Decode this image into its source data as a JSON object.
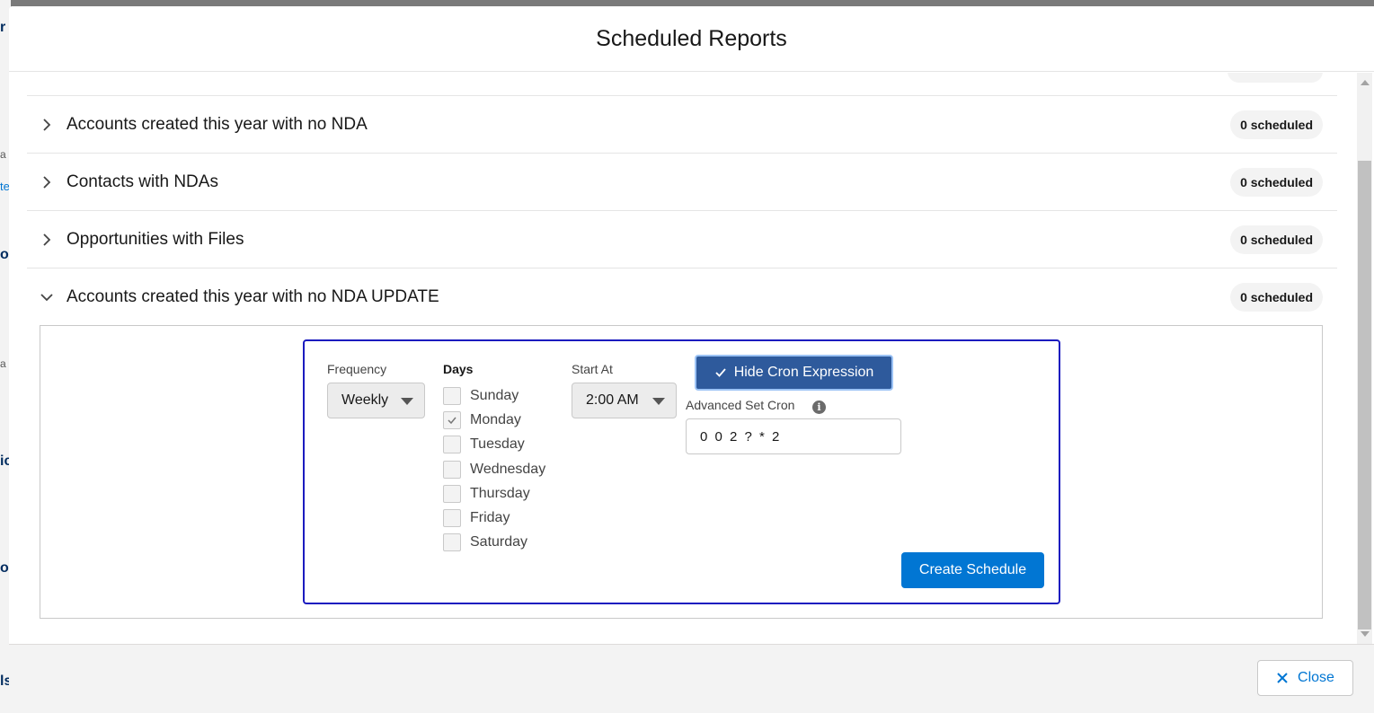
{
  "background": {
    "fragments": [
      "r",
      "a",
      "te",
      "o",
      "a",
      "ic",
      "o",
      "ls"
    ]
  },
  "modal": {
    "title": "Scheduled Reports"
  },
  "reports": [
    {
      "title": "Accounts created this year with no NDA",
      "badge": "0 scheduled",
      "expanded": false
    },
    {
      "title": "Contacts with NDAs",
      "badge": "0 scheduled",
      "expanded": false
    },
    {
      "title": "Opportunities with Files",
      "badge": "0 scheduled",
      "expanded": false
    },
    {
      "title": "Accounts created this year with no NDA UPDATE",
      "badge": "0 scheduled",
      "expanded": true
    }
  ],
  "schedule_form": {
    "frequency_label": "Frequency",
    "frequency_value": "Weekly",
    "days_label": "Days",
    "days": [
      {
        "label": "Sunday",
        "checked": false
      },
      {
        "label": "Monday",
        "checked": true
      },
      {
        "label": "Tuesday",
        "checked": false
      },
      {
        "label": "Wednesday",
        "checked": false
      },
      {
        "label": "Thursday",
        "checked": false
      },
      {
        "label": "Friday",
        "checked": false
      },
      {
        "label": "Saturday",
        "checked": false
      }
    ],
    "start_at_label": "Start At",
    "start_at_value": "2:00 AM",
    "hide_cron_button": "Hide Cron Expression",
    "advanced_cron_label": "Advanced Set Cron",
    "info_icon": "i",
    "cron_value": "0 0 2 ? * 2",
    "create_button": "Create Schedule"
  },
  "footer": {
    "close_label": "Close"
  },
  "colors": {
    "brand_blue": "#0176d3",
    "hide_cron_bg": "#2e5a9c",
    "form_border": "#1b1bbf"
  },
  "icons": {
    "collapsed": "chevron-right-icon",
    "expanded": "chevron-down-icon",
    "check": "check-icon",
    "info": "info-icon",
    "close": "close-icon"
  }
}
